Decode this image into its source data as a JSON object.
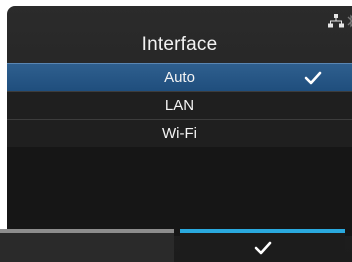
{
  "header": {
    "title": "Interface",
    "status_icons": [
      "network-icon",
      "bluetooth-icon"
    ]
  },
  "list": {
    "items": [
      {
        "label": "Auto",
        "selected": true
      },
      {
        "label": "LAN",
        "selected": false
      },
      {
        "label": "Wi-Fi",
        "selected": false
      }
    ]
  },
  "footer": {
    "left_button": {
      "label": ""
    },
    "right_button": {
      "icon": "check-icon"
    }
  },
  "colors": {
    "selection": "#2f5f8e",
    "confirm_accent": "#2aa9de",
    "back_accent": "#8d8d8d"
  }
}
